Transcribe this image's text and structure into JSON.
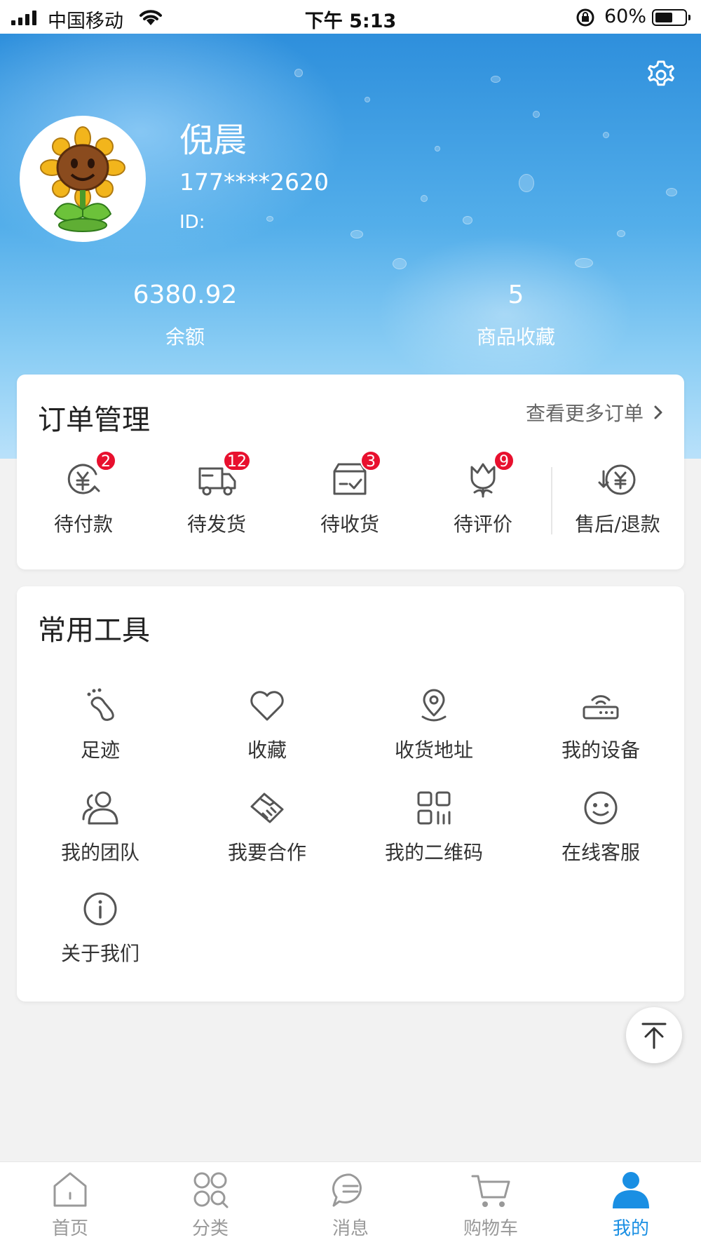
{
  "status_bar": {
    "carrier": "中国移动",
    "time": "下午 5:13",
    "battery_percent": "60%",
    "battery_level": 0.6
  },
  "profile": {
    "name": "倪晨",
    "phone": "177****2620",
    "id_label": "ID:",
    "settings_icon": "gear-icon",
    "avatar_icon": "sunflower-avatar"
  },
  "stats": [
    {
      "value": "6380.92",
      "label": "余额"
    },
    {
      "value": "5",
      "label": "商品收藏"
    }
  ],
  "orders": {
    "title": "订单管理",
    "more_label": "查看更多订单",
    "items": [
      {
        "label": "待付款",
        "badge": "2",
        "icon": "yuan-clock-icon"
      },
      {
        "label": "待发货",
        "badge": "12",
        "icon": "truck-icon"
      },
      {
        "label": "待收货",
        "badge": "3",
        "icon": "package-check-icon"
      },
      {
        "label": "待评价",
        "badge": "9",
        "icon": "tulip-icon"
      },
      {
        "label": "售后/退款",
        "badge": "",
        "icon": "refund-icon"
      }
    ]
  },
  "tools": {
    "title": "常用工具",
    "items": [
      {
        "label": "足迹",
        "icon": "footprint-icon"
      },
      {
        "label": "收藏",
        "icon": "heart-icon"
      },
      {
        "label": "收货地址",
        "icon": "location-pin-icon"
      },
      {
        "label": "我的设备",
        "icon": "router-icon"
      },
      {
        "label": "我的团队",
        "icon": "team-icon"
      },
      {
        "label": "我要合作",
        "icon": "handshake-icon"
      },
      {
        "label": "我的二维码",
        "icon": "qrcode-icon"
      },
      {
        "label": "在线客服",
        "icon": "smiley-icon"
      },
      {
        "label": "关于我们",
        "icon": "info-icon"
      }
    ]
  },
  "tab_bar": {
    "items": [
      {
        "label": "首页",
        "icon": "home-icon",
        "active": false
      },
      {
        "label": "分类",
        "icon": "category-icon",
        "active": false
      },
      {
        "label": "消息",
        "icon": "message-icon",
        "active": false
      },
      {
        "label": "购物车",
        "icon": "cart-icon",
        "active": false
      },
      {
        "label": "我的",
        "icon": "user-icon",
        "active": true
      }
    ]
  },
  "colors": {
    "accent": "#1a8fe3",
    "badge": "#e8102e",
    "icon_gray": "#555555",
    "tab_inactive": "#999999"
  }
}
